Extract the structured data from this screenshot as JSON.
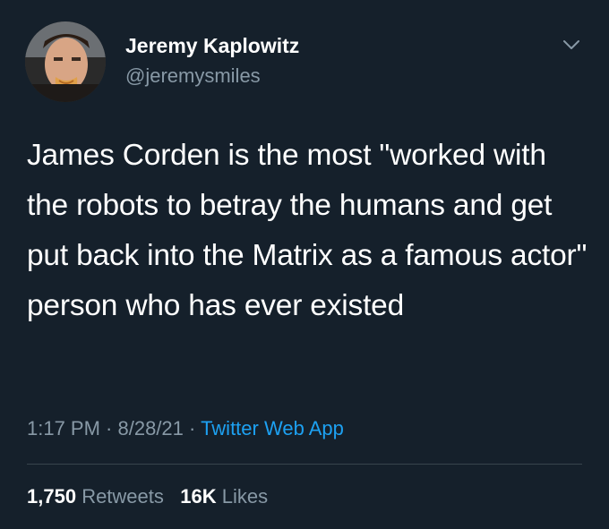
{
  "author": {
    "name": "Jeremy Kaplowitz",
    "handle": "@jeremysmiles"
  },
  "tweet": {
    "text": "James Corden is the most \"worked with the robots to betray the humans and get put back into the Matrix as a famous actor\" person who has ever existed"
  },
  "meta": {
    "time": "1:17 PM",
    "sep1": " · ",
    "date": "8/28/21",
    "sep2": " · ",
    "source": "Twitter Web App"
  },
  "stats": {
    "retweets_count": "1,750",
    "retweets_label": "Retweets",
    "likes_count": "16K",
    "likes_label": "Likes"
  },
  "colors": {
    "background": "#15202b",
    "primary_text": "#ffffff",
    "secondary_text": "#8899a6",
    "link": "#1da1f2",
    "divider": "#38444d"
  },
  "icons": {
    "more": "chevron-down-icon"
  }
}
